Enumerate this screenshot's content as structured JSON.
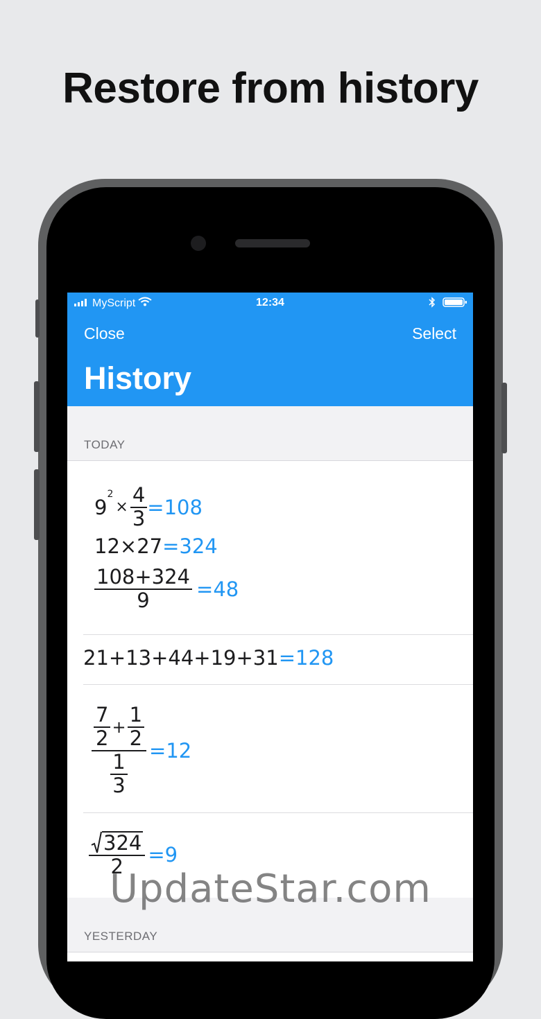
{
  "headline": "Restore from history",
  "status_bar": {
    "carrier": "MyScript",
    "time": "12:34"
  },
  "nav": {
    "close_label": "Close",
    "select_label": "Select",
    "title": "History"
  },
  "sections": {
    "today_label": "TODAY",
    "yesterday_label": "YESTERDAY"
  },
  "entries": {
    "e1": {
      "line1": {
        "base": "9",
        "exp": "2",
        "op": "×",
        "num": "4",
        "den": "3",
        "result": "=108"
      },
      "line2": {
        "expr": "12×27",
        "result": "=324"
      },
      "line3": {
        "num": "108+324",
        "den": "9",
        "result": "=48"
      }
    },
    "e2": {
      "expr": "21+13+44+19+31",
      "result": "=128"
    },
    "e3": {
      "n1": "7",
      "d1": "2",
      "op": "+",
      "n2": "1",
      "d2": "2",
      "den_num": "1",
      "den_den": "3",
      "result": "=12"
    },
    "e4": {
      "radicand": "324",
      "den": "2",
      "result": "=9"
    }
  },
  "watermark": "UpdateStar.com",
  "colors": {
    "accent": "#2196f3",
    "background": "#e8e9eb"
  }
}
